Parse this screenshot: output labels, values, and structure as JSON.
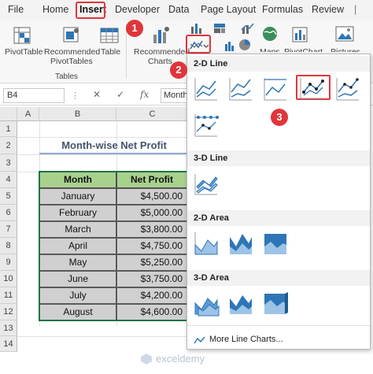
{
  "ribbon_tabs": [
    "File",
    "Home",
    "Insert",
    "Developer",
    "Data",
    "Page Layout",
    "Formulas",
    "Review"
  ],
  "ribbon": {
    "pivottable": "PivotTable",
    "recommended_pivottables_1": "Recommended",
    "recommended_pivottables_2": "PivotTables",
    "table": "Table",
    "group_tables": "Tables",
    "recommended_charts_1": "Recommended",
    "recommended_charts_2": "Charts",
    "maps": "Maps",
    "pivotchart": "PivotChart",
    "pictures": "Pictures"
  },
  "formula_bar": {
    "name_box": "B4",
    "fx": "fx",
    "value": "Month"
  },
  "columns": [
    "A",
    "B",
    "C"
  ],
  "rows": [
    "1",
    "2",
    "3",
    "4",
    "5",
    "6",
    "7",
    "8",
    "9",
    "10",
    "11",
    "12",
    "13",
    "14"
  ],
  "sheet": {
    "title": "Month-wise Net Profit",
    "headers": [
      "Month",
      "Net Profit"
    ],
    "data": [
      [
        "January",
        "$4,500.00"
      ],
      [
        "February",
        "$5,000.00"
      ],
      [
        "March",
        "$3,800.00"
      ],
      [
        "April",
        "$4,750.00"
      ],
      [
        "May",
        "$5,250.00"
      ],
      [
        "June",
        "$3,750.00"
      ],
      [
        "July",
        "$4,200.00"
      ],
      [
        "August",
        "$4,600.00"
      ]
    ]
  },
  "dropdown": {
    "section_2d_line": "2-D Line",
    "section_3d_line": "3-D Line",
    "section_2d_area": "2-D Area",
    "section_3d_area": "3-D Area",
    "more_line_charts": "More Line Charts..."
  },
  "steps": [
    "1",
    "2",
    "3"
  ],
  "colors": {
    "callout_red": "#e0353b",
    "header_green": "#a9d18e",
    "data_gray": "#d0d0d0",
    "chart_blue": "#2e75b6"
  },
  "watermark": "exceldemy"
}
